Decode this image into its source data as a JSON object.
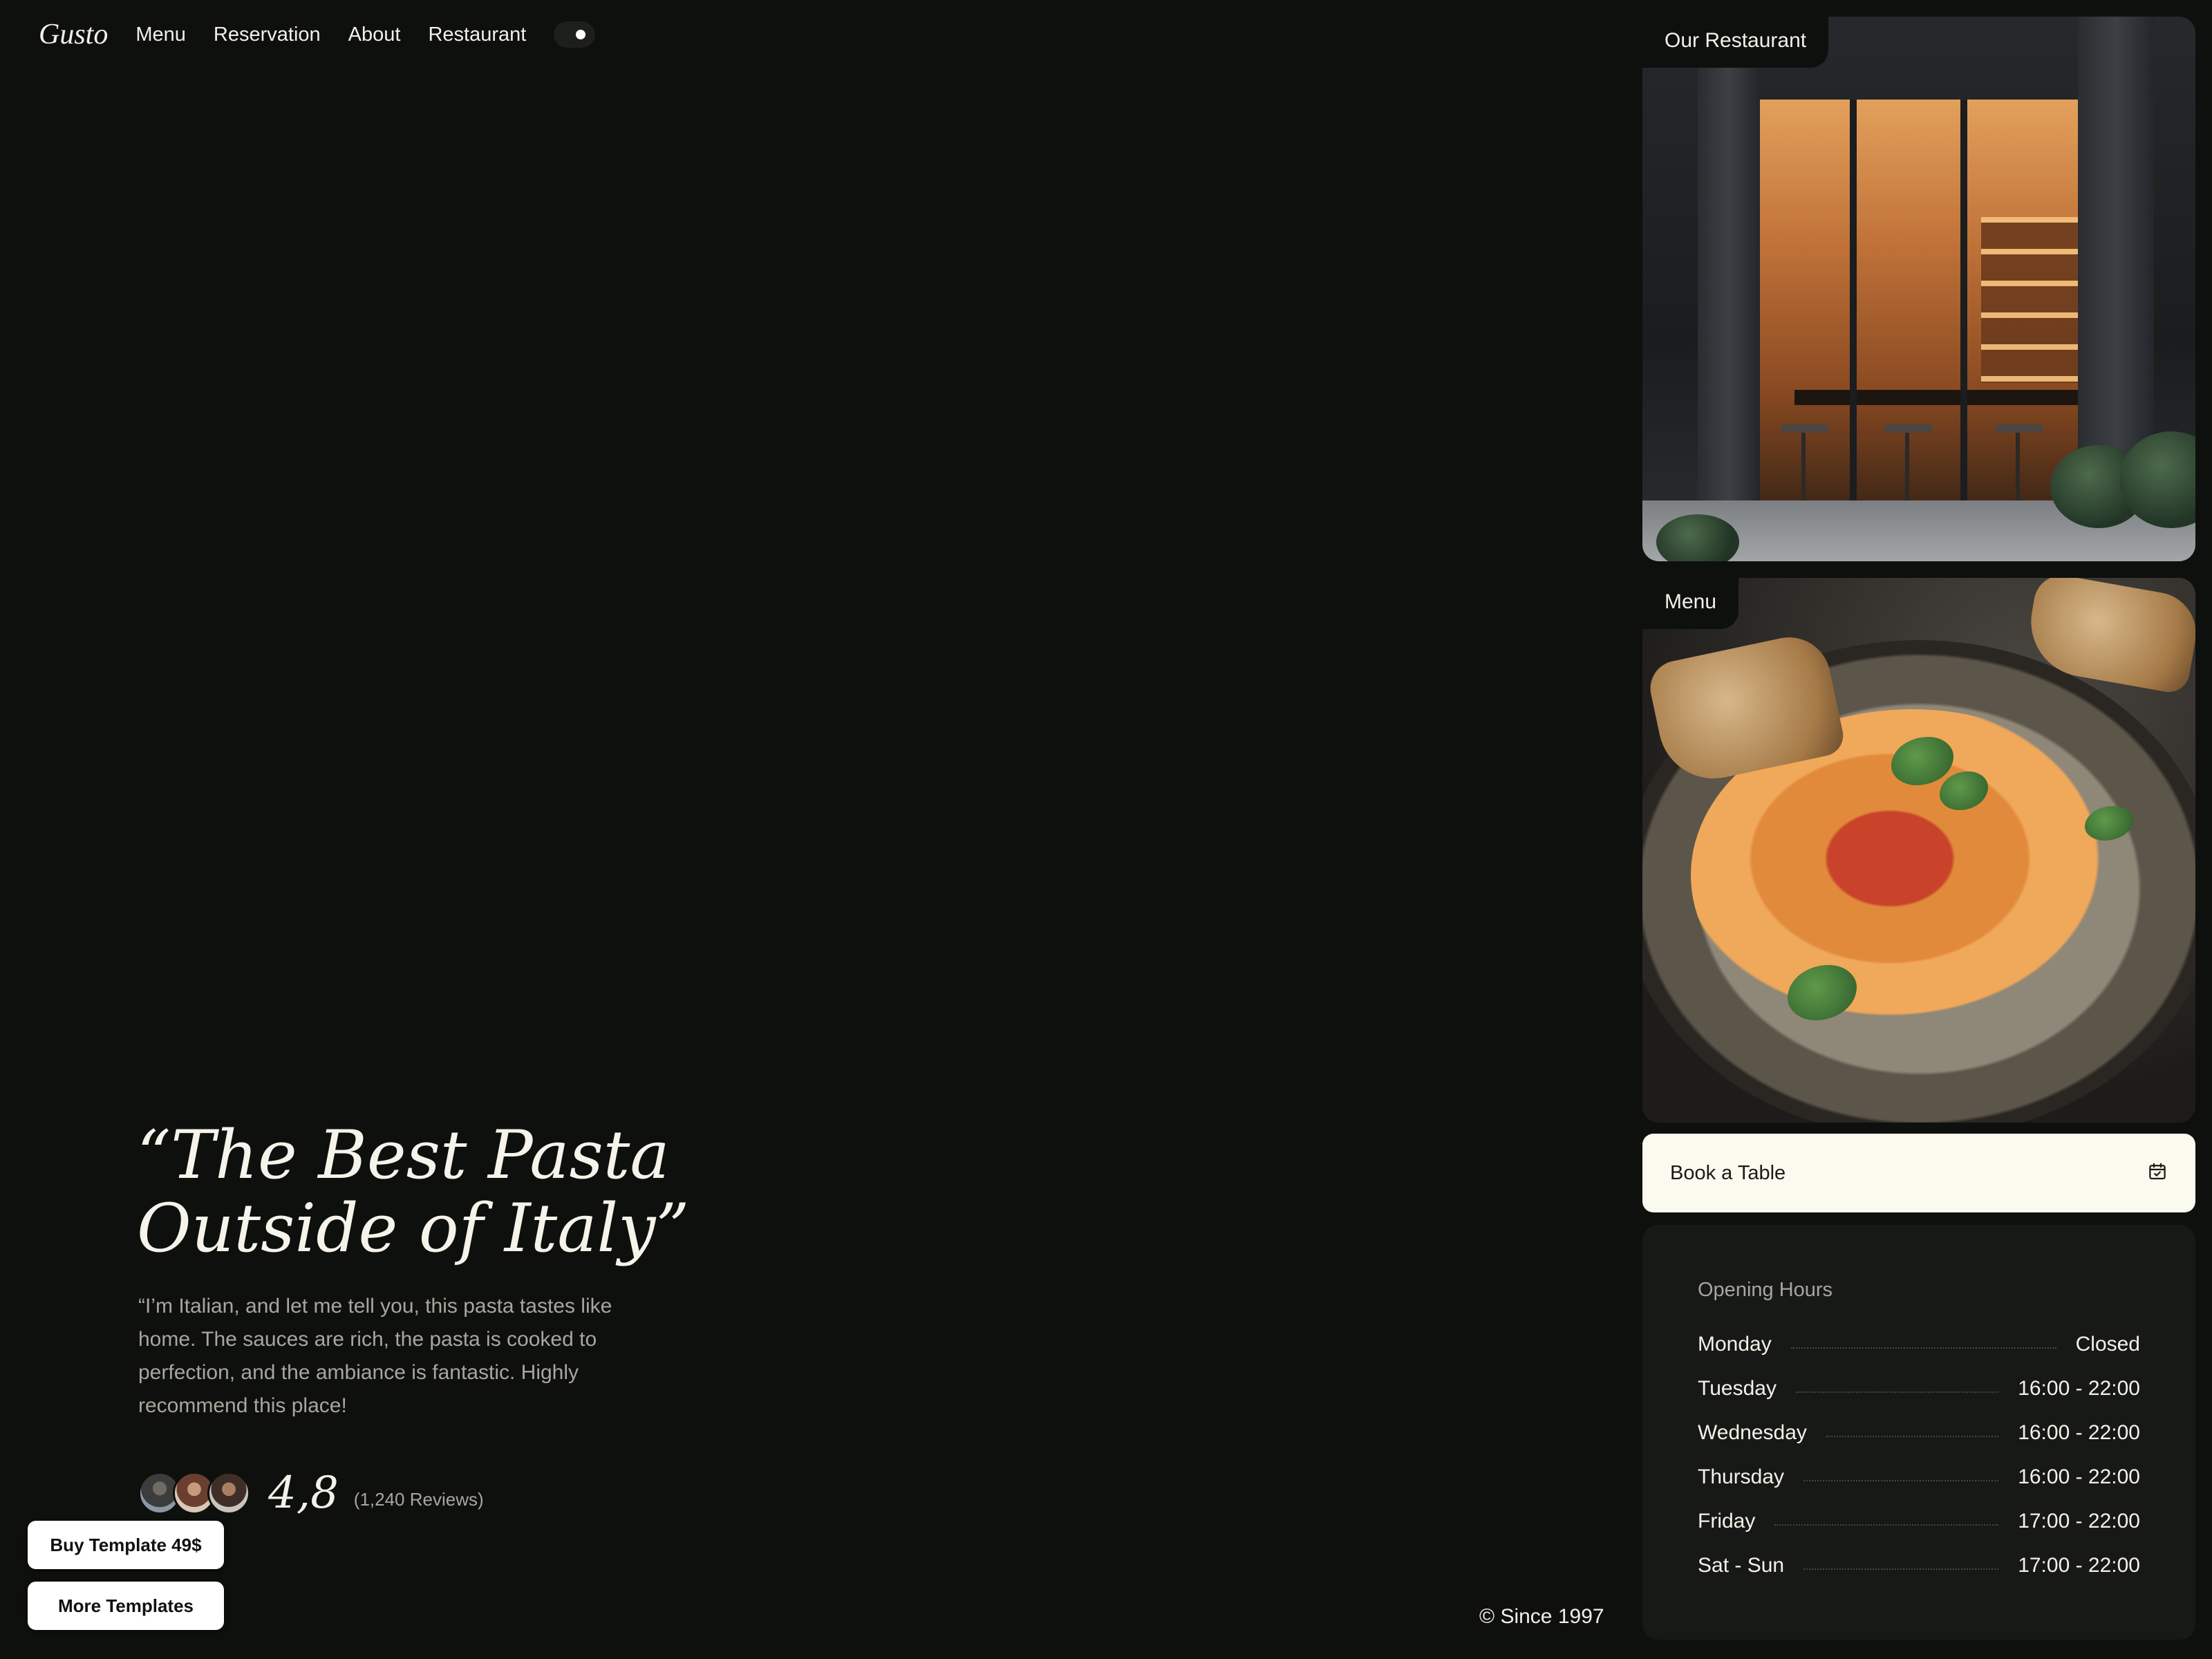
{
  "brand": {
    "logo": "Gusto"
  },
  "nav": {
    "items": [
      {
        "label": "Menu"
      },
      {
        "label": "Reservation"
      },
      {
        "label": "About"
      },
      {
        "label": "Restaurant"
      }
    ]
  },
  "hero": {
    "title_line1": "“The Best Pasta",
    "title_line2": "Outside of Italy”",
    "quote": "“I’m Italian, and let me tell you, this pasta tastes like home. The sauces are rich, the pasta is cooked to perfection, and the ambiance is fantastic. Highly recommend this place!",
    "rating": "4,8",
    "reviews": "(1,240 Reviews)"
  },
  "buttons": {
    "buy": "Buy Template 49$",
    "more": "More Templates"
  },
  "footer": {
    "since": "© Since 1997"
  },
  "cards": {
    "restaurant": {
      "label": "Our Restaurant"
    },
    "menu": {
      "label": "Menu"
    }
  },
  "book": {
    "label": "Book a Table",
    "icon": "calendar-icon"
  },
  "hours": {
    "title": "Opening Hours",
    "rows": [
      {
        "day": "Monday",
        "time": "Closed"
      },
      {
        "day": "Tuesday",
        "time": "16:00 - 22:00"
      },
      {
        "day": "Wednesday",
        "time": "16:00 - 22:00"
      },
      {
        "day": "Thursday",
        "time": "16:00 - 22:00"
      },
      {
        "day": "Friday",
        "time": "17:00 - 22:00"
      },
      {
        "day": "Sat - Sun",
        "time": "17:00 - 22:00"
      }
    ]
  },
  "colors": {
    "background": "#0e100d",
    "text": "#f2efe6",
    "muted": "#a9a69d",
    "book_bg": "#fbfaef",
    "hours_bg": "#171916"
  }
}
